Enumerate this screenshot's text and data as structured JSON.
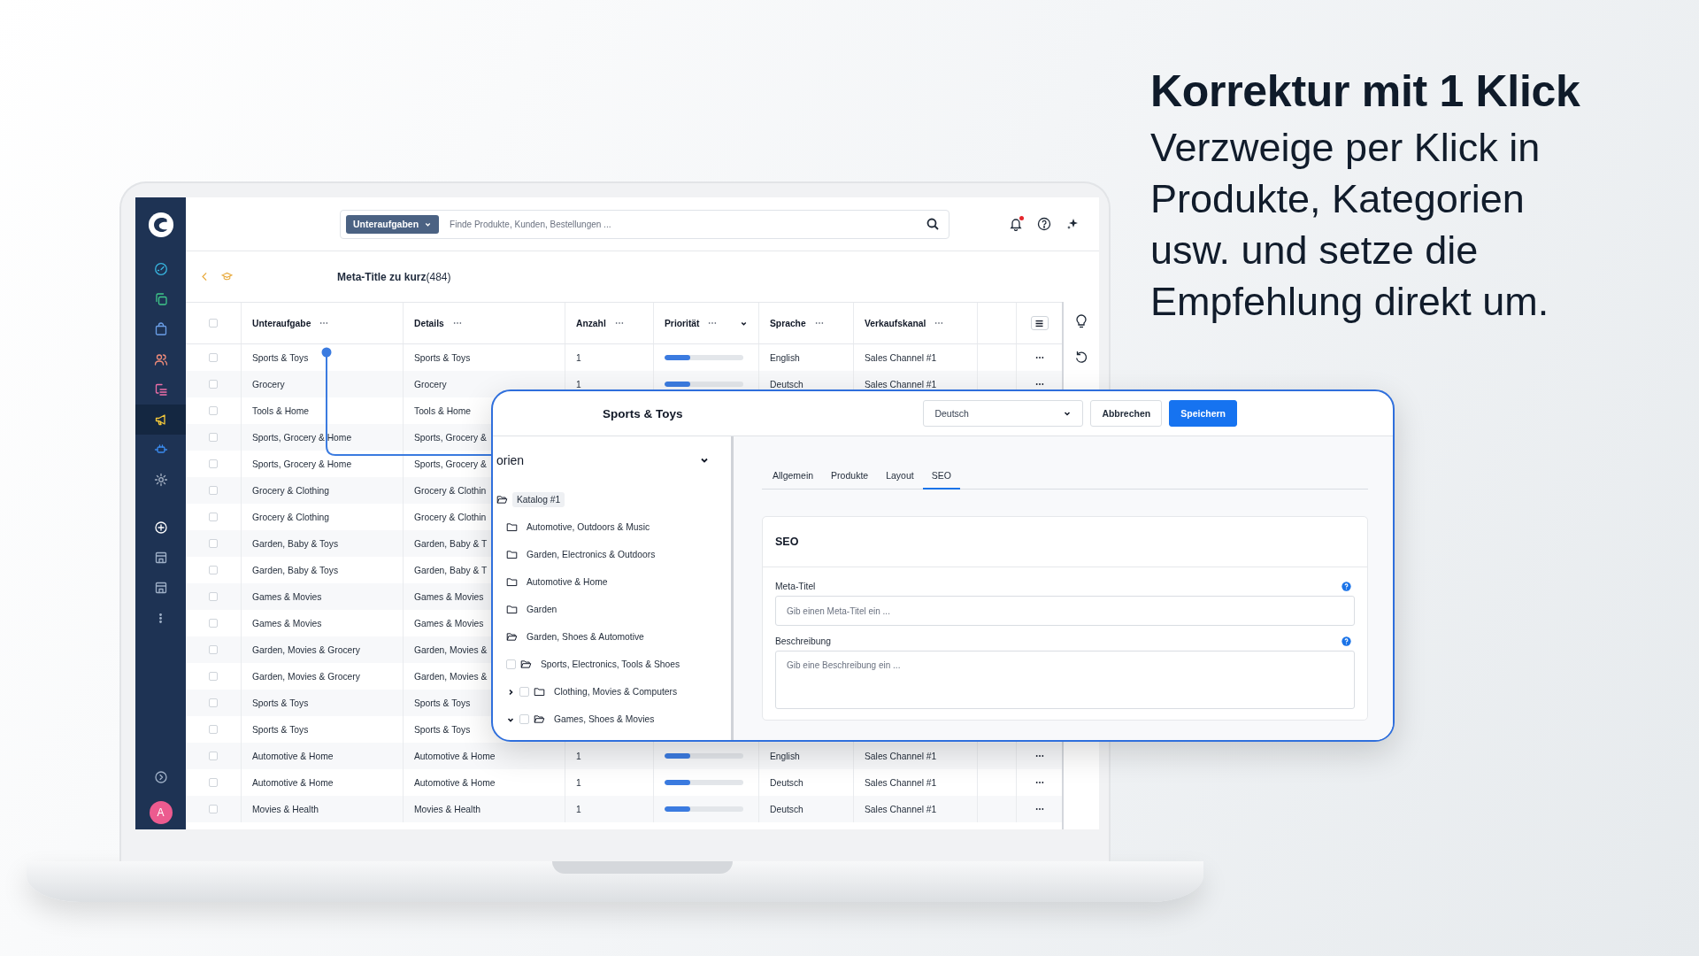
{
  "headline": {
    "title": "Korrektur mit 1 Klick",
    "text": "Verzweige per Klick in Produkte, Kategorien usw. und setze die Empfehlung direkt um."
  },
  "sidebar": {
    "items": [
      {
        "kind": "dashboard",
        "selected": false
      },
      {
        "kind": "copy",
        "selected": false
      },
      {
        "kind": "bag",
        "selected": false
      },
      {
        "kind": "users",
        "selected": false
      },
      {
        "kind": "list",
        "selected": false
      },
      {
        "kind": "megaphone",
        "selected": true
      },
      {
        "kind": "plug",
        "selected": false
      },
      {
        "kind": "gear",
        "selected": false
      }
    ],
    "tools": [
      {
        "kind": "plus",
        "selected": false
      },
      {
        "kind": "store",
        "selected": false
      },
      {
        "kind": "store",
        "selected": false
      },
      {
        "kind": "more",
        "selected": false
      }
    ],
    "bottom": [
      {
        "kind": "arrow",
        "selected": false
      }
    ],
    "avatar": "A"
  },
  "topbar": {
    "filter_label": "Unteraufgaben",
    "search_placeholder": "Finde Produkte, Kunden, Bestellungen ...",
    "notification": true
  },
  "page": {
    "title": "**Meta-Title zu kurz**(484)"
  },
  "table": {
    "select_all_checked": false,
    "columns": [
      {
        "label": "Unteraufgabe",
        "dropdown": false
      },
      {
        "label": "Details",
        "dropdown": false
      },
      {
        "label": "Anzahl",
        "dropdown": false
      },
      {
        "label": "Priorität",
        "dropdown": true
      },
      {
        "label": "Sprache",
        "dropdown": false
      },
      {
        "label": "Verkaufskanal",
        "dropdown": false
      }
    ],
    "rows": [
      {
        "checked": false,
        "subtask": "Sports & Toys",
        "details": "Sports & Toys",
        "count": "1",
        "level": 0.33,
        "language": "English",
        "channel": "Sales Channel #1"
      },
      {
        "checked": false,
        "subtask": "Grocery",
        "details": "Grocery",
        "count": "1",
        "level": 0.33,
        "language": "Deutsch",
        "channel": "Sales Channel #1"
      },
      {
        "checked": false,
        "subtask": "Tools & Home",
        "details": "Tools & Home"
      },
      {
        "checked": false,
        "subtask": "Sports, Grocery & Home",
        "details": "Sports, Grocery &"
      },
      {
        "checked": false,
        "subtask": "Sports, Grocery & Home",
        "details": "Sports, Grocery &"
      },
      {
        "checked": false,
        "subtask": "Grocery & Clothing",
        "details": "Grocery & Clothin"
      },
      {
        "checked": false,
        "subtask": "Grocery & Clothing",
        "details": "Grocery & Clothin"
      },
      {
        "checked": false,
        "subtask": "Garden, Baby & Toys",
        "details": "Garden, Baby & T"
      },
      {
        "checked": false,
        "subtask": "Garden, Baby & Toys",
        "details": "Garden, Baby & T"
      },
      {
        "checked": false,
        "subtask": "Games & Movies",
        "details": "Games & Movies"
      },
      {
        "checked": false,
        "subtask": "Games & Movies",
        "details": "Games & Movies"
      },
      {
        "checked": false,
        "subtask": "Garden, Movies & Grocery",
        "details": "Garden, Movies &"
      },
      {
        "checked": false,
        "subtask": "Garden, Movies & Grocery",
        "details": "Garden, Movies &"
      },
      {
        "checked": false,
        "subtask": "Sports & Toys",
        "details": "Sports & Toys"
      },
      {
        "checked": false,
        "subtask": "Sports & Toys",
        "details": "Sports & Toys"
      },
      {
        "checked": false,
        "subtask": "Automotive & Home",
        "details": "Automotive & Home",
        "count": "1",
        "level": 0.33,
        "language": "English",
        "channel": "Sales Channel #1"
      },
      {
        "checked": false,
        "subtask": "Automotive & Home",
        "details": "Automotive & Home",
        "count": "1",
        "level": 0.33,
        "language": "Deutsch",
        "channel": "Sales Channel #1"
      },
      {
        "checked": false,
        "subtask": "Movies & Health",
        "details": "Movies & Health",
        "count": "1",
        "level": 0.33,
        "language": "Deutsch",
        "channel": "Sales Channel #1"
      }
    ]
  },
  "dialog": {
    "title": "Sports & Toys",
    "language": "Deutsch",
    "cancel": "Abbrechen",
    "save": "Speichern",
    "tree_heading": "orien",
    "tree": [
      {
        "label": "Katalog #1",
        "selected": true,
        "expanded": true,
        "children": [
          {
            "label": "Automotive, Outdoors & Music",
            "selected": false,
            "expanded": false
          },
          {
            "label": "Garden, Electronics & Outdoors",
            "selected": false,
            "expanded": false
          },
          {
            "label": "Automotive & Home",
            "selected": false,
            "expanded": false
          },
          {
            "label": "Garden",
            "selected": false,
            "expanded": false
          },
          {
            "label": "Garden, Shoes & Automotive",
            "selected": false,
            "expanded": true,
            "children": [
              {
                "label": "Sports, Electronics, Tools & Shoes",
                "selected": false,
                "expanded": true,
                "checked": false,
                "children": [
                  {
                    "label": "Clothing, Movies & Computers",
                    "selected": false,
                    "expanded": false,
                    "checked": false
                  },
                  {
                    "label": "Games, Shoes & Movies",
                    "selected": false,
                    "expanded": true,
                    "checked": false
                  }
                ]
              }
            ]
          }
        ]
      }
    ],
    "tabs": [
      {
        "label": "Allgemein",
        "selected": false
      },
      {
        "label": "Produkte",
        "selected": false
      },
      {
        "label": "Layout",
        "selected": false
      },
      {
        "label": "SEO",
        "selected": true
      }
    ],
    "section_title": "SEO",
    "fields": [
      {
        "kind": "input",
        "label": "Meta-Titel",
        "placeholder": "Gib einen Meta-Titel ein ..."
      },
      {
        "kind": "textarea",
        "label": "Beschreibung",
        "placeholder": "Gib eine Beschreibung ein ..."
      }
    ]
  }
}
